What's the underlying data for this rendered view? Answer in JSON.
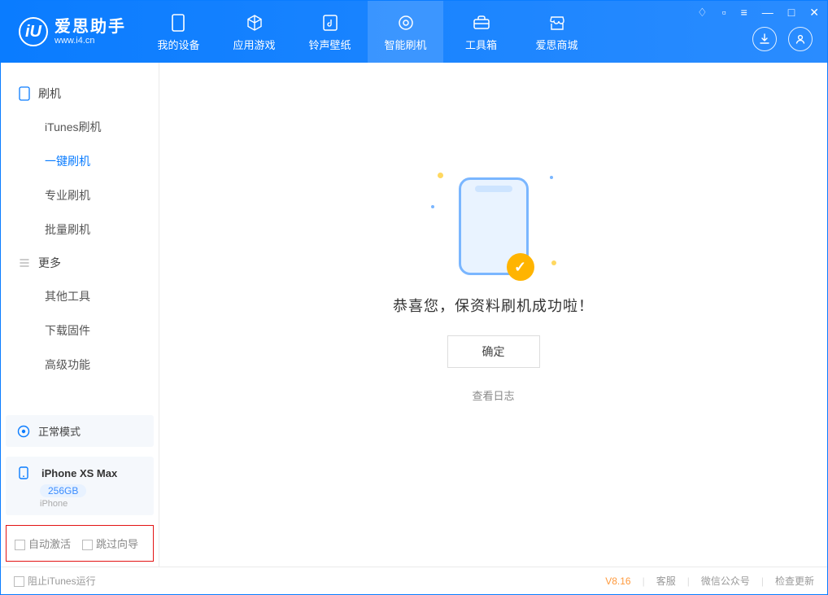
{
  "logo": {
    "cn": "爱思助手",
    "en": "www.i4.cn",
    "mark": "iU"
  },
  "nav": [
    {
      "label": "我的设备",
      "icon": "device"
    },
    {
      "label": "应用游戏",
      "icon": "cube"
    },
    {
      "label": "铃声壁纸",
      "icon": "music"
    },
    {
      "label": "智能刷机",
      "icon": "gear",
      "active": true
    },
    {
      "label": "工具箱",
      "icon": "toolbox"
    },
    {
      "label": "爱思商城",
      "icon": "shop"
    }
  ],
  "sidebar": {
    "group1": {
      "title": "刷机",
      "items": [
        "iTunes刷机",
        "一键刷机",
        "专业刷机",
        "批量刷机"
      ],
      "active_index": 1
    },
    "group2": {
      "title": "更多",
      "items": [
        "其他工具",
        "下载固件",
        "高级功能"
      ]
    }
  },
  "device_mode": "正常模式",
  "device": {
    "name": "iPhone XS Max",
    "storage": "256GB",
    "type": "iPhone"
  },
  "options": {
    "auto_activate": "自动激活",
    "skip_guide": "跳过向导"
  },
  "main": {
    "message": "恭喜您，保资料刷机成功啦！",
    "ok": "确定",
    "log": "查看日志"
  },
  "footer": {
    "block_itunes": "阻止iTunes运行",
    "version": "V8.16",
    "links": [
      "客服",
      "微信公众号",
      "检查更新"
    ]
  }
}
